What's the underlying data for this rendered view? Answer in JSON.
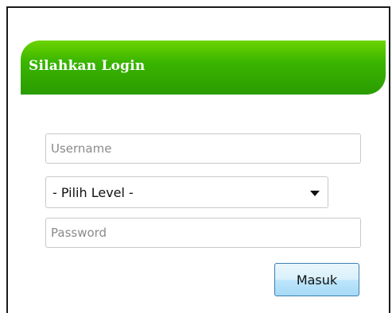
{
  "login": {
    "title": "Silahkan Login",
    "username_placeholder": "Username",
    "level_select_value": "- Pilih Level -",
    "password_placeholder": "Password",
    "submit_label": "Masuk"
  },
  "colors": {
    "header_green": "#3ab500",
    "button_border": "#3c7fb1"
  }
}
